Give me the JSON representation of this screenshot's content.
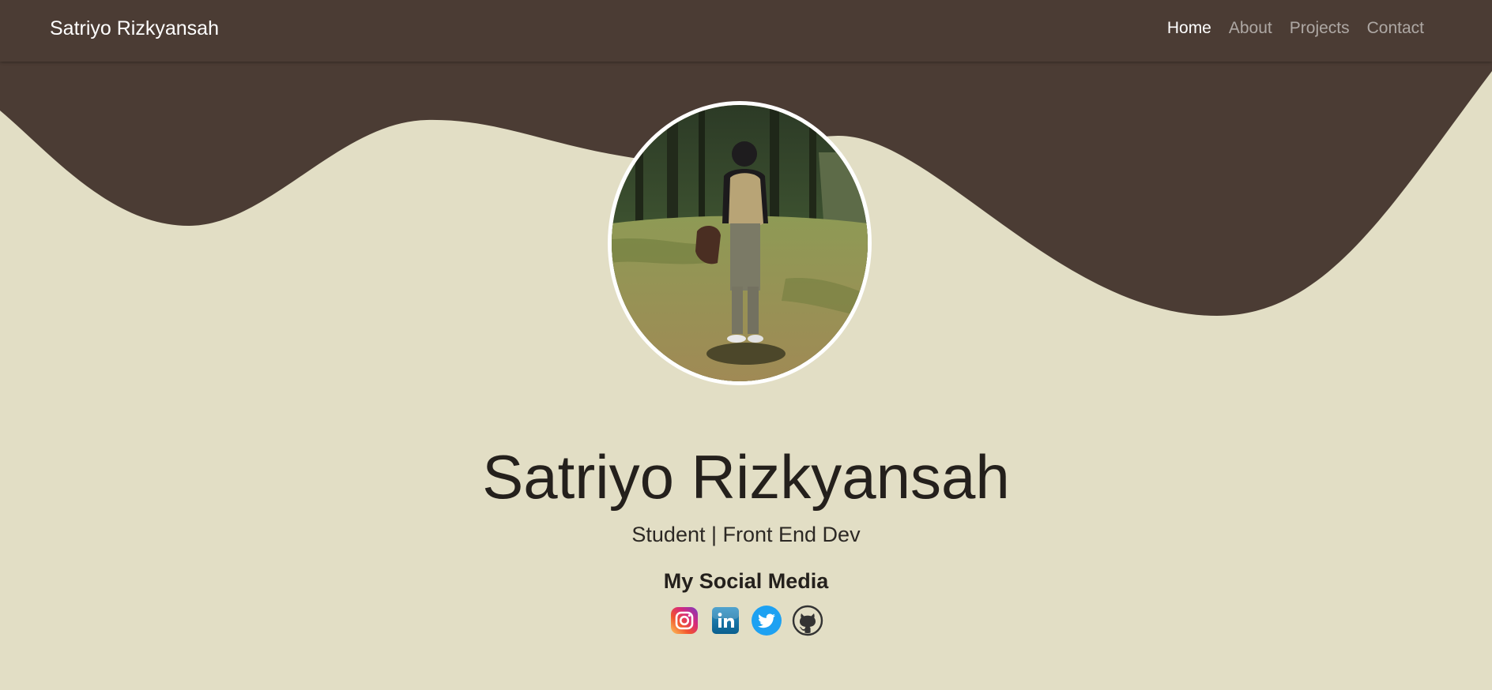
{
  "navbar": {
    "brand": "Satriyo Rizkyansah",
    "links": [
      {
        "label": "Home",
        "active": true
      },
      {
        "label": "About",
        "active": false
      },
      {
        "label": "Projects",
        "active": false
      },
      {
        "label": "Contact",
        "active": false
      }
    ]
  },
  "hero": {
    "name": "Satriyo Rizkyansah",
    "subtitle": "Student | Front End Dev",
    "social_heading": "My Social Media",
    "social": [
      {
        "name": "Instagram",
        "icon": "instagram-icon"
      },
      {
        "name": "LinkedIn",
        "icon": "linkedin-icon"
      },
      {
        "name": "Twitter",
        "icon": "twitter-icon"
      },
      {
        "name": "GitHub",
        "icon": "github-icon"
      }
    ]
  },
  "colors": {
    "header_brown": "#4b3c34",
    "background_beige": "#e2dec5",
    "text_dark": "#24201c",
    "twitter_blue": "#1da1f2",
    "linkedin_blue": "#0e76a8"
  }
}
